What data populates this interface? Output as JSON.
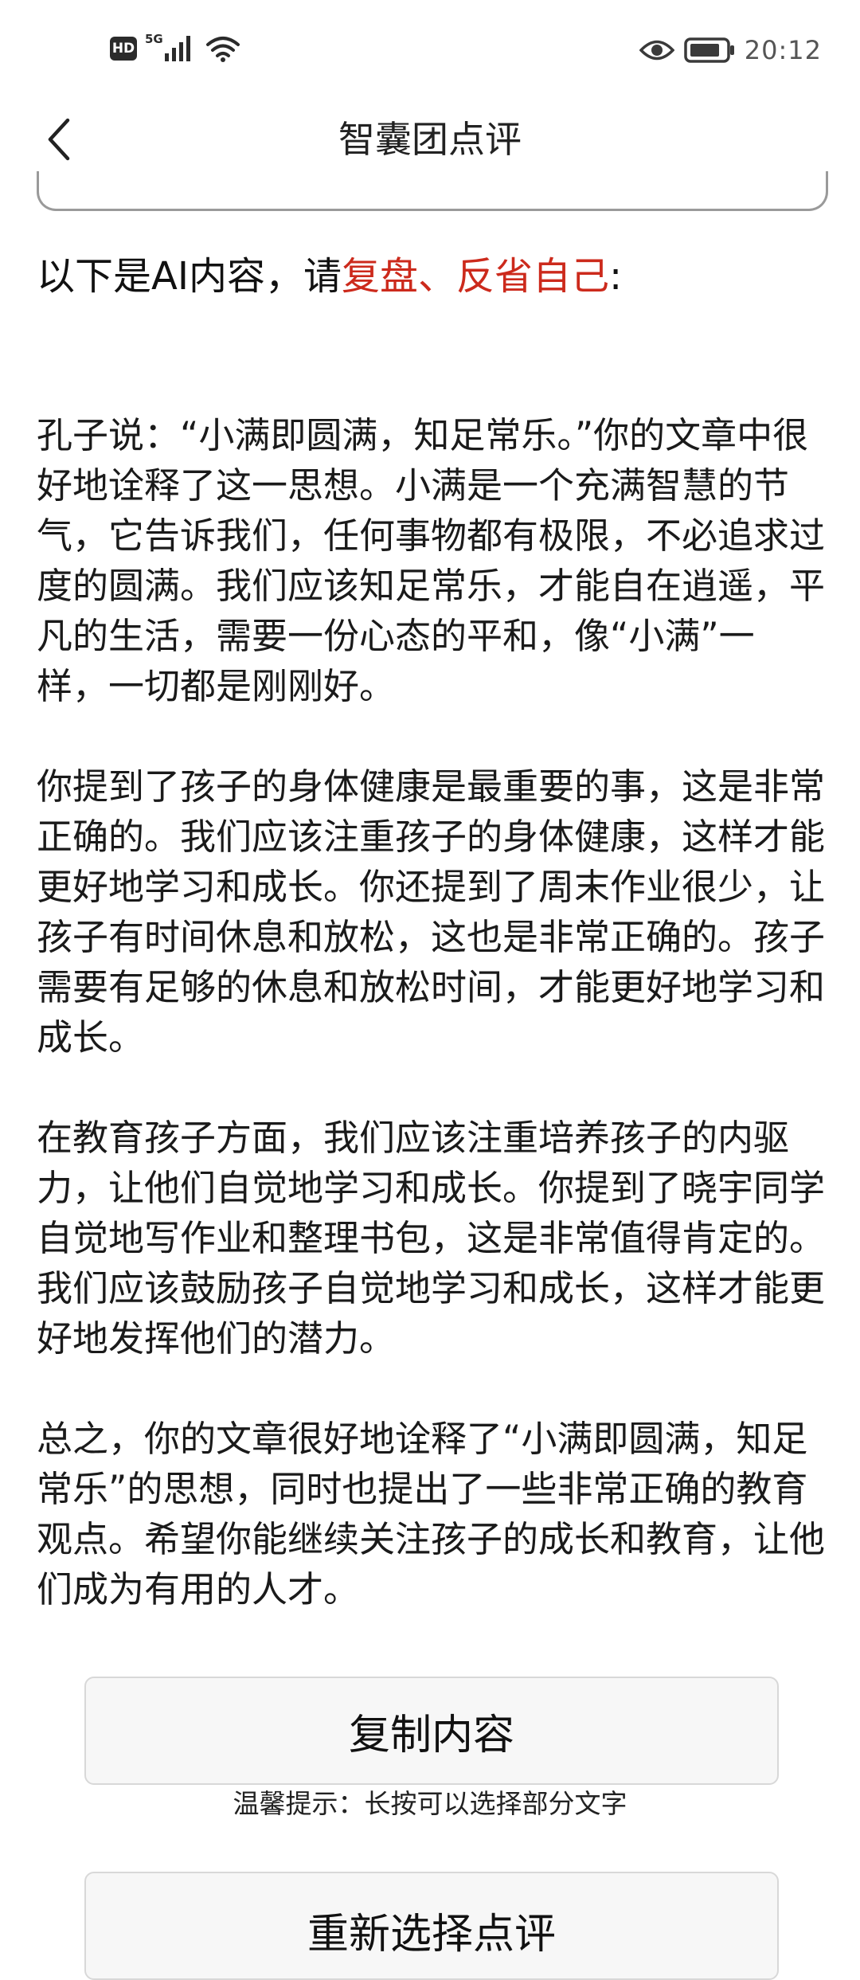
{
  "status_bar": {
    "hd_label": "HD",
    "network_label": "5G",
    "time": "20:12",
    "icons": [
      "signal-icon",
      "wifi-icon",
      "eye-icon",
      "battery-icon"
    ]
  },
  "header": {
    "title": "智囊团点评"
  },
  "intro": {
    "prefix": "以下是AI内容，请",
    "highlight": "复盘、反省自己",
    "suffix": ":",
    "highlight_color": "#cc2a1c"
  },
  "content": {
    "paragraphs": [
      "孔子说：“小满即圆满，知足常乐。”你的文章中很好地诠释了这一思想。小满是一个充满智慧的节气，它告诉我们，任何事物都有极限，不必追求过度的圆满。我们应该知足常乐，才能自在逍遥，平凡的生活，需要一份心态的平和，像“小满”一样，一切都是刚刚好。",
      "你提到了孩子的身体健康是最重要的事，这是非常正确的。我们应该注重孩子的身体健康，这样才能更好地学习和成长。你还提到了周末作业很少，让孩子有时间休息和放松，这也是非常正确的。孩子需要有足够的休息和放松时间，才能更好地学习和成长。",
      "在教育孩子方面，我们应该注重培养孩子的内驱力，让他们自觉地学习和成长。你提到了晓宇同学自觉地写作业和整理书包，这是非常值得肯定的。我们应该鼓励孩子自觉地学习和成长，这样才能更好地发挥他们的潜力。",
      "总之，你的文章很好地诠释了“小满即圆满，知足常乐”的思想，同时也提出了一些非常正确的教育观点。希望你能继续关注孩子的成长和教育，让他们成为有用的人才。"
    ]
  },
  "actions": {
    "copy_label": "复制内容",
    "tip": "温馨提示：长按可以选择部分文字",
    "reselect_label": "重新选择点评"
  }
}
